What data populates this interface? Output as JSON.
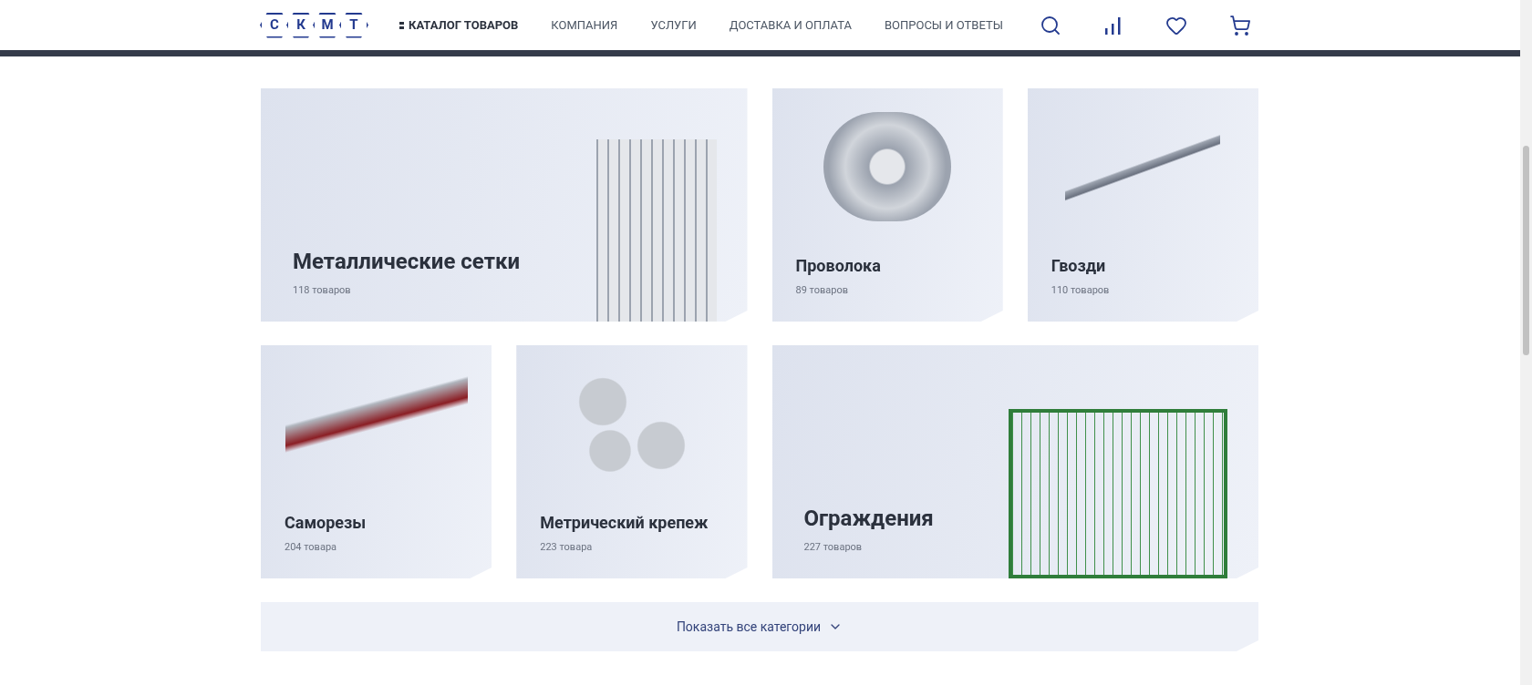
{
  "header": {
    "logo_letters": [
      "С",
      "К",
      "М",
      "Т"
    ],
    "nav": [
      {
        "label": "КАТАЛОГ ТОВАРОВ",
        "selected": true
      },
      {
        "label": "КОМПАНИЯ",
        "selected": false
      },
      {
        "label": "УСЛУГИ",
        "selected": false
      },
      {
        "label": "ДОСТАВКА И ОПЛАТА",
        "selected": false
      },
      {
        "label": "ВОПРОСЫ И ОТВЕТЫ",
        "selected": false
      }
    ]
  },
  "categories": [
    {
      "title": "Металлические сетки",
      "count": "118 товаров",
      "wide": true,
      "kind": "mesh"
    },
    {
      "title": "Проволока",
      "count": "89 товаров",
      "wide": false,
      "kind": "wire"
    },
    {
      "title": "Гвозди",
      "count": "110 товаров",
      "wide": false,
      "kind": "nails"
    },
    {
      "title": "Саморезы",
      "count": "204 товара",
      "wide": false,
      "kind": "screws"
    },
    {
      "title": "Метрический крепеж",
      "count": "223 товара",
      "wide": false,
      "kind": "bolts"
    },
    {
      "title": "Ограждения",
      "count": "227 товаров",
      "wide": true,
      "kind": "fence"
    }
  ],
  "show_all": {
    "label": "Показать все категории"
  }
}
